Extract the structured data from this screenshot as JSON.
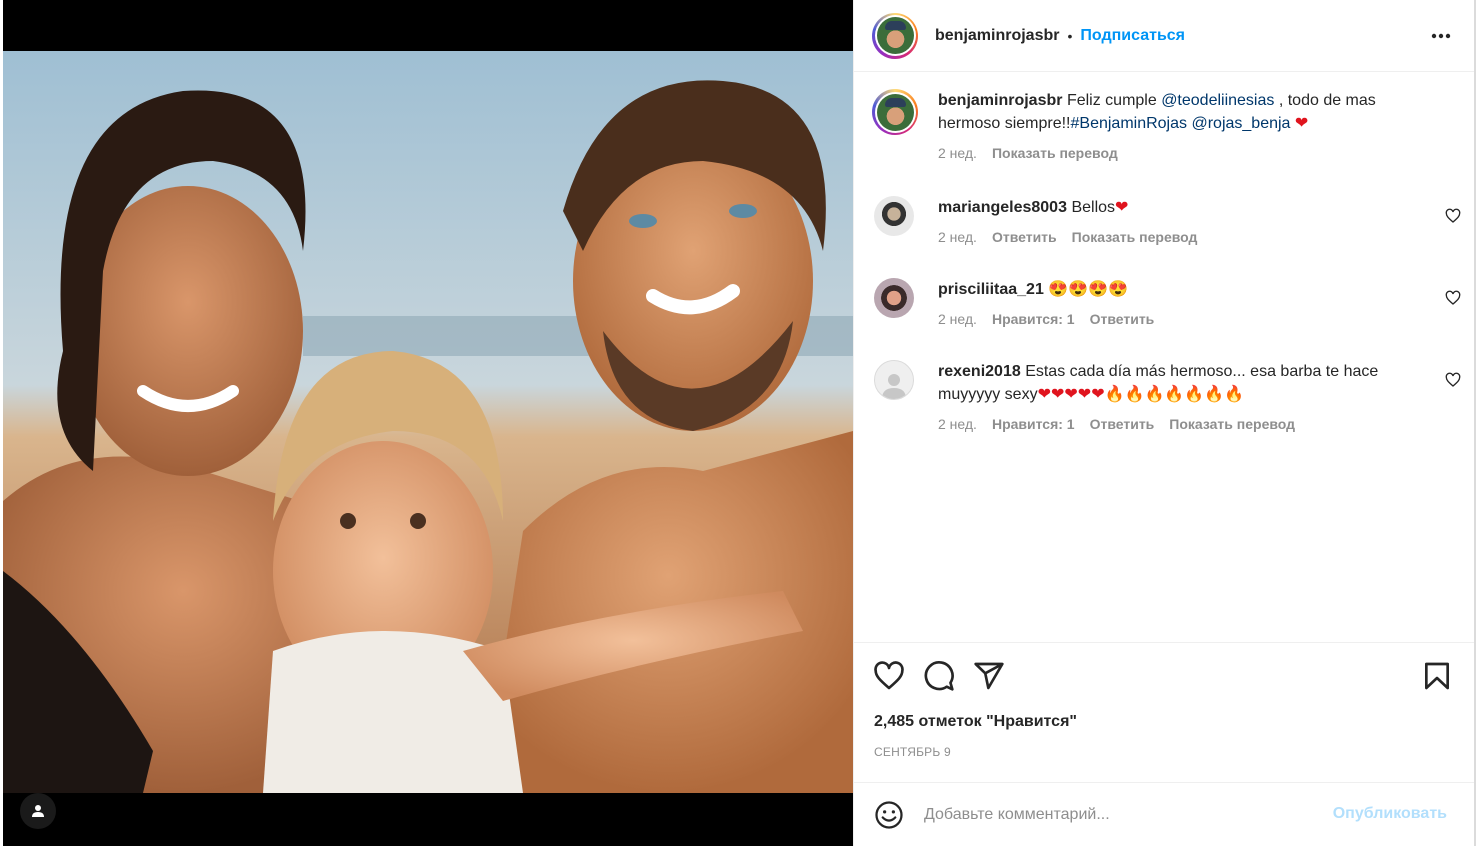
{
  "post": {
    "username": "benjaminrojasbr",
    "separator": "•",
    "follow_label": "Подписаться",
    "more_icon": "more-horizontal-icon"
  },
  "caption": {
    "username": "benjaminrojasbr",
    "text_1": "Feliz cumple ",
    "mention_1": "@teodeliinesias",
    "text_2": " , todo de mas hermoso siempre!!",
    "hashtag": "#BenjaminRojas",
    "text_3": " ",
    "mention_2": "@rojas_benja",
    "emoji": "❤",
    "time": "2 нед.",
    "translate": "Показать перевод"
  },
  "comments": [
    {
      "username": "mariangeles8003",
      "text": "Bellos",
      "emoji": "❤",
      "time": "2 нед.",
      "reply": "Ответить",
      "translate": "Показать перевод"
    },
    {
      "username": "prisciliitaa_21",
      "text": "",
      "emoji": "😍😍😍😍",
      "time": "2 нед.",
      "likes": "Нравится: 1",
      "reply": "Ответить"
    },
    {
      "username": "rexeni2018",
      "text": "Estas cada día más hermoso... esa barba te hace muyyyyy sexy",
      "emoji_hearts": "❤❤❤❤❤",
      "emoji_fire": "🔥🔥🔥🔥🔥🔥🔥",
      "time": "2 нед.",
      "likes": "Нравится: 1",
      "reply": "Ответить",
      "translate": "Показать перевод"
    }
  ],
  "actions": {
    "like_icon": "heart-icon",
    "comment_icon": "comment-icon",
    "share_icon": "share-icon",
    "save_icon": "bookmark-icon"
  },
  "likes_count": "2,485 отметок \"Нравится\"",
  "date": "СЕНТЯБРЬ 9",
  "add_comment": {
    "placeholder": "Добавьте комментарий...",
    "post_label": "Опубликовать",
    "emoji_icon": "smile-icon"
  },
  "colors": {
    "link": "#0095f6",
    "mention": "#00376b",
    "muted": "#8e8e8e",
    "text": "#262626",
    "post_disabled": "#b2dffc"
  }
}
